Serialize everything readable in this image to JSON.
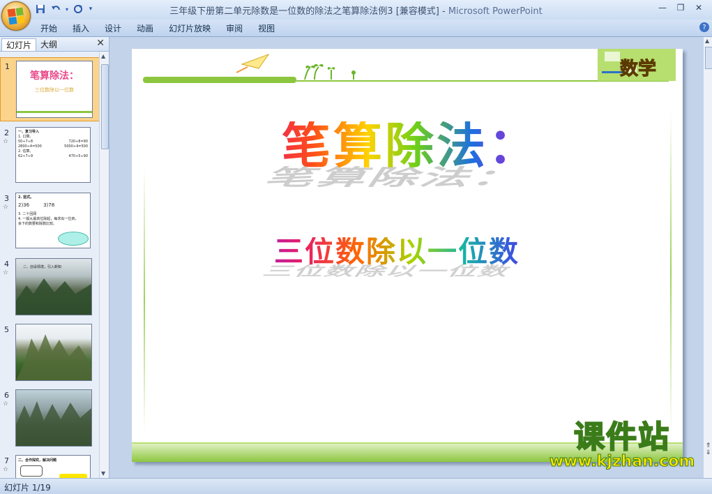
{
  "window": {
    "title": "三年级下册第二单元除数是一位数的除法之笔算除法例3 [兼容模式]",
    "title_sep": " - ",
    "app_name": "Microsoft PowerPoint"
  },
  "qat": {
    "save_icon": "save-icon",
    "undo_icon": "undo-icon",
    "redo_icon": "redo-icon"
  },
  "ribbon": {
    "tabs": [
      "开始",
      "插入",
      "设计",
      "动画",
      "幻灯片放映",
      "审阅",
      "视图"
    ]
  },
  "slide_pane": {
    "tab_slides": "幻灯片",
    "tab_outline": "大纲",
    "thumbnails": [
      {
        "num": "1",
        "star": "",
        "title": "笔算除法：",
        "subtitle": "三位数除以一位数"
      },
      {
        "num": "2",
        "star": "☆",
        "title": "一、复习导入",
        "lines": [
          "1. 口算。",
          "50÷7≈8",
          "720÷8=90",
          "2800÷4=500",
          "5000÷4=500",
          "2. 估算。",
          "62÷7≈9",
          "470÷5≈90"
        ]
      },
      {
        "num": "3",
        "star": "☆",
        "title": "2. 竖式。",
        "lines": [
          "2)36",
          "3)78",
          "3. 二十回顾",
          "4. 一般从最高位除起，每求出一位商，",
          "余下的数要和除数比较。"
        ]
      },
      {
        "num": "4",
        "star": "☆",
        "title": "二、创设情境，引入新知"
      },
      {
        "num": "5",
        "star": "",
        "title": ""
      },
      {
        "num": "6",
        "star": "☆",
        "title": ""
      },
      {
        "num": "7",
        "star": "☆",
        "title": "二、合作探究，解决问题"
      }
    ]
  },
  "slide": {
    "title": "笔算除法：",
    "subtitle": "三位数除以一位数",
    "badge": "数学"
  },
  "watermark": {
    "text": "课件站",
    "url": "www.kjzhan.com"
  },
  "status": {
    "slide_indicator": "幻灯片 1/19"
  }
}
